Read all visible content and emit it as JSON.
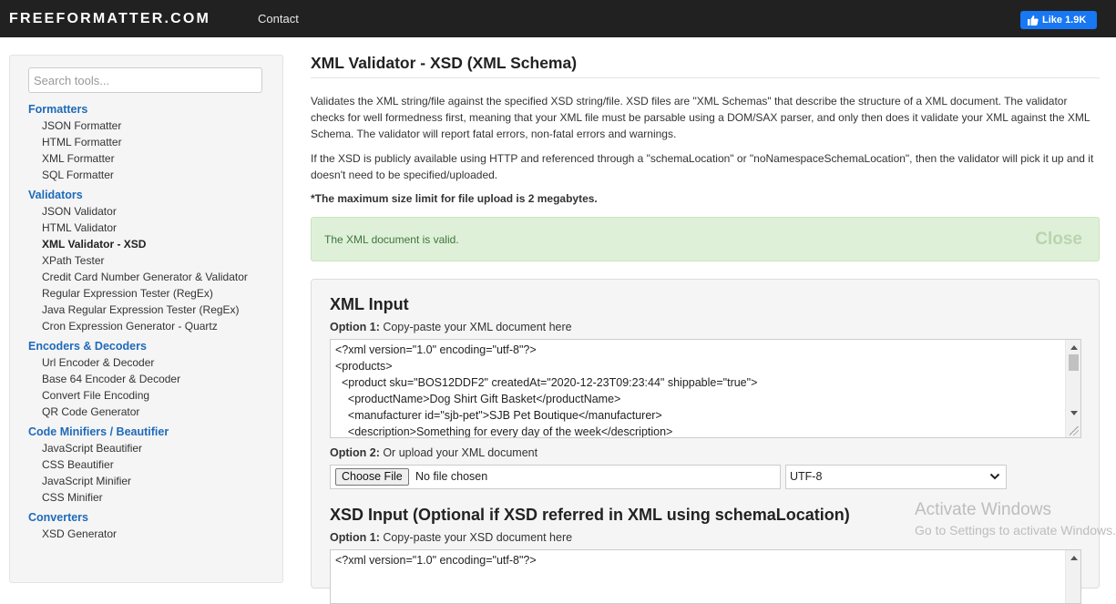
{
  "nav": {
    "brand": "FREEFORMATTER.COM",
    "contact": "Contact",
    "fb_like": "Like 1.9K"
  },
  "sidebar": {
    "search_placeholder": "Search tools...",
    "categories": [
      {
        "title": "Formatters",
        "items": [
          "JSON Formatter",
          "HTML Formatter",
          "XML Formatter",
          "SQL Formatter"
        ]
      },
      {
        "title": "Validators",
        "items": [
          "JSON Validator",
          "HTML Validator",
          "XML Validator - XSD",
          "XPath Tester",
          "Credit Card Number Generator & Validator",
          "Regular Expression Tester (RegEx)",
          "Java Regular Expression Tester (RegEx)",
          "Cron Expression Generator - Quartz"
        ]
      },
      {
        "title": "Encoders & Decoders",
        "items": [
          "Url Encoder & Decoder",
          "Base 64 Encoder & Decoder",
          "Convert File Encoding",
          "QR Code Generator"
        ]
      },
      {
        "title": "Code Minifiers / Beautifier",
        "items": [
          "JavaScript Beautifier",
          "CSS Beautifier",
          "JavaScript Minifier",
          "CSS Minifier"
        ]
      },
      {
        "title": "Converters",
        "items": [
          "XSD Generator"
        ]
      }
    ],
    "active_item": "XML Validator - XSD"
  },
  "main": {
    "title": "XML Validator - XSD (XML Schema)",
    "desc1": "Validates the XML string/file against the specified XSD string/file. XSD files are \"XML Schemas\" that describe the structure of a XML document. The validator checks for well formedness first, meaning that your XML file must be parsable using a DOM/SAX parser, and only then does it validate your XML against the XML Schema. The validator will report fatal errors, non-fatal errors and warnings.",
    "desc2": "If the XSD is publicly available using HTTP and referenced through a \"schemaLocation\" or \"noNamespaceSchemaLocation\", then the validator will pick it up and it doesn't need to be specified/uploaded.",
    "limit": "*The maximum size limit for file upload is 2 megabytes.",
    "alert": {
      "text": "The XML document is valid.",
      "close": "Close"
    },
    "xml_input": {
      "title": "XML Input",
      "option1_bold": "Option 1:",
      "option1_text": " Copy-paste your XML document here",
      "lines": [
        "<?xml version=\"1.0\" encoding=\"utf-8\"?>",
        "<products>",
        "  <product sku=\"BOS12DDF2\" createdAt=\"2020-12-23T09:23:44\" shippable=\"true\">",
        "    <productName>Dog Shirt Gift Basket</productName>",
        "    <manufacturer id=\"sjb-pet\">SJB Pet Boutique</manufacturer>",
        "    <description>Something for every day of the week</description>"
      ],
      "option2_bold": "Option 2:",
      "option2_text": " Or upload your XML document",
      "choose_file": "Choose File",
      "no_file": "No file chosen",
      "encoding": "UTF-8"
    },
    "xsd_input": {
      "title": "XSD Input (Optional if XSD referred in XML using schemaLocation)",
      "option1_bold": "Option 1:",
      "option1_text": " Copy-paste your XSD document here",
      "lines": [
        "<?xml version=\"1.0\" encoding=\"utf-8\"?>"
      ]
    }
  },
  "watermark": {
    "line1": "Activate Windows",
    "line2": "Go to Settings to activate Windows."
  },
  "colors": {
    "topbar": "#212121",
    "link": "#1e6ab9",
    "alert_bg": "#dff0d8",
    "fb": "#1877f2"
  }
}
